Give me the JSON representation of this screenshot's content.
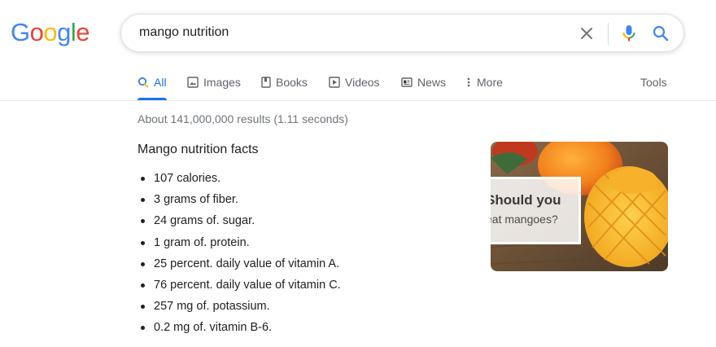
{
  "logo": {
    "letters": [
      "G",
      "o",
      "o",
      "g",
      "l",
      "e"
    ],
    "colors": [
      "#4285f4",
      "#ea4335",
      "#fbbc05",
      "#4285f4",
      "#34a853",
      "#ea4335"
    ]
  },
  "search": {
    "query": "mango nutrition",
    "icons": [
      "clear-icon",
      "microphone-icon",
      "search-icon"
    ]
  },
  "tabs": [
    {
      "label": "All",
      "icon": "search-icon",
      "active": true
    },
    {
      "label": "Images",
      "icon": "image-icon"
    },
    {
      "label": "Books",
      "icon": "book-icon"
    },
    {
      "label": "Videos",
      "icon": "play-icon"
    },
    {
      "label": "News",
      "icon": "newspaper-icon"
    },
    {
      "label": "More",
      "icon": "more-vertical-icon"
    },
    {
      "label": "Tools"
    }
  ],
  "result_stats": "About 141,000,000 results (1.11 seconds)",
  "snippet": {
    "title": "Mango nutrition facts",
    "facts": [
      "107 calories.",
      "3 grams of fiber.",
      "24 grams of. sugar.",
      "1 gram of. protein.",
      "25 percent. daily value of vitamin A.",
      "76 percent. daily value of vitamin C.",
      "257 mg of. potassium.",
      "0.2 mg of. vitamin B-6."
    ],
    "thumbnail": {
      "title": "Should you",
      "subtitle": "eat mangoes?"
    }
  },
  "colors": {
    "accent": "#1a73e8",
    "tab_text": "#5f6368",
    "stats_text": "#70757a"
  }
}
